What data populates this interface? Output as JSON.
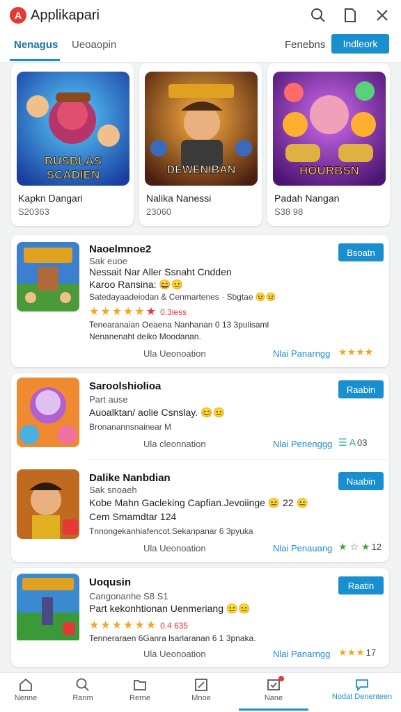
{
  "header": {
    "title": "Applikapari",
    "logo_letter": "A"
  },
  "tabs": [
    {
      "label": "Nenagus"
    },
    {
      "label": "Ueoaopin"
    }
  ],
  "filter": {
    "label": "Fenebns",
    "button": "Indleork"
  },
  "featured": [
    {
      "name": "Kapkn Dangari",
      "price": "S20363",
      "art": "RUSBLAS SCADIEN"
    },
    {
      "name": "Nalika Nanessi",
      "price": "23060",
      "art": "DEWENIBAN"
    },
    {
      "name": "Padah Nangan",
      "price": "S38 98",
      "art": "HOURBSN"
    }
  ],
  "items": [
    {
      "title": "Naoelmnoe2",
      "sub": "Sak euoe",
      "desc1": "Nessait Nar Aller Ssnaht Cndden",
      "desc2": "Karoo Ransina: 😄😐",
      "sub2": "Satedayaadeiodan & Cenmartenes · Sbgtae 😐😐",
      "stars": "★★★★★",
      "star_extra": "★",
      "rating_note": "0.3iess",
      "line1": "Tenearanaian Oeaena Nanhanan 0 13 3pulisaml",
      "line2": "Nenanenaht deiko Moodanan.",
      "foot": "Ula Ueonoation",
      "link": "Nlai Panarngg",
      "mini": "★★★★",
      "mini_num": "",
      "button": "Bsoatn"
    },
    {
      "title": "Saroolshiolioa",
      "sub": "Part ause",
      "desc1": "Auoalktan/ aolie Csnslay. 😊😐",
      "sub2": "Bronanannsnainear M",
      "foot": "Ula cleonnation",
      "link": "Nlai Penenggg",
      "mini": "☰ A",
      "mini_num": "03",
      "button": "Raabin"
    },
    {
      "title": "Dalike Nanbdian",
      "sub": "Sak snoaeh",
      "desc1": "Kobe Mahn Gacleking Capfian.Jevoiinge 😐 22 😐",
      "desc2": "Cem Smamdtar 124",
      "sub2": "Tnnongekanhiafencot.Sekanpanar 6 3pyuka",
      "foot": "Ula Ueonoation",
      "link": "Nlai Penauang",
      "mini": "★ ☆ ★",
      "mini_num": "12",
      "button": "Naabin"
    },
    {
      "title": "Uoqusin",
      "sub": "Cangonanhe S8 S1",
      "desc1": "Part kekonhtionan Uenmeriang 😐😐",
      "stars": "★★★★★★",
      "rating_note": "0.4 635",
      "line1": "Tenneraraen 6Ganra lsarlaranan 6 1 3pnaka.",
      "foot": "Ula Ueonoation",
      "link": "Nlai Panarngg",
      "mini": "★★★",
      "mini_num": "17",
      "button": "Raatin"
    }
  ],
  "bottom_nav": [
    {
      "label": "Nenne",
      "icon": "home-icon"
    },
    {
      "label": "Ranm",
      "icon": "search-icon"
    },
    {
      "label": "Rerne",
      "icon": "folder-icon"
    },
    {
      "label": "Mnoe",
      "icon": "edit-icon"
    },
    {
      "label": "Nane",
      "icon": "inbox-icon"
    },
    {
      "label": "Nodat Denenteen",
      "icon": "chat-icon"
    }
  ],
  "colors": {
    "accent": "#1a8fd0",
    "star": "#f5a623",
    "badge": "#e53935"
  }
}
